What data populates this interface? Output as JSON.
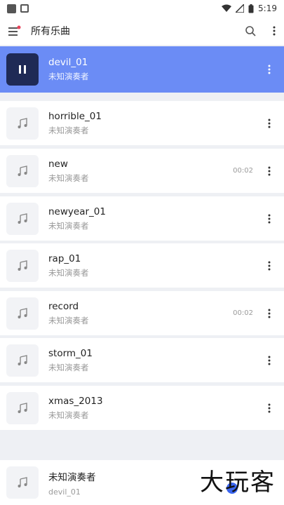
{
  "status_bar": {
    "time": "5:19"
  },
  "app_bar": {
    "title": "所有乐曲"
  },
  "songs": [
    {
      "title": "devil_01",
      "artist": "未知演奏者",
      "duration": ""
    },
    {
      "title": "horrible_01",
      "artist": "未知演奏者",
      "duration": ""
    },
    {
      "title": "new",
      "artist": "未知演奏者",
      "duration": "00:02"
    },
    {
      "title": "newyear_01",
      "artist": "未知演奏者",
      "duration": ""
    },
    {
      "title": "rap_01",
      "artist": "未知演奏者",
      "duration": ""
    },
    {
      "title": "record",
      "artist": "未知演奏者",
      "duration": "00:02"
    },
    {
      "title": "storm_01",
      "artist": "未知演奏者",
      "duration": ""
    },
    {
      "title": "xmas_2013",
      "artist": "未知演奏者",
      "duration": ""
    }
  ],
  "mini_player": {
    "title": "未知演奏者",
    "subtitle": "devil_01"
  },
  "watermark": {
    "text": "大玩客"
  },
  "colors": {
    "active_row": "#6b8cf5",
    "playing_thumb": "#1f2a55",
    "accent": "#3b66f0"
  }
}
